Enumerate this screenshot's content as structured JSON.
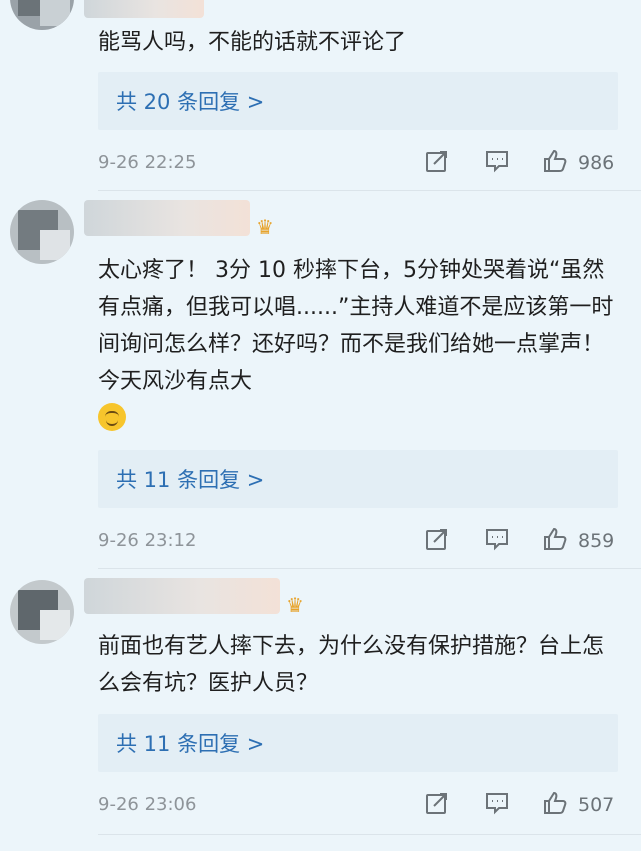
{
  "comments": [
    {
      "text": "能骂人吗，不能的话就不评论了",
      "replies": "共 20 条回复 >",
      "time": "9-26 22:25",
      "likes": "986"
    },
    {
      "text": "太心疼了！ 3分 10 秒摔下台，5分钟处哭着说“虽然有点痛，但我可以唱......”主持人难道不是应该第一时间询问怎么样？还好吗？而不是我们给她一点掌声！今天风沙有点大",
      "replies": "共 11 条回复 >",
      "time": "9-26 23:12",
      "likes": "859"
    },
    {
      "text": "前面也有艺人摔下去，为什么没有保护措施？台上怎么会有坑？医护人员？",
      "replies": "共 11 条回复 >",
      "time": "9-26 23:06",
      "likes": "507"
    }
  ],
  "icons": {
    "share": "share-icon",
    "comment": "comment-icon",
    "like": "thumbs-up-icon",
    "crown": "crown-icon",
    "emoji": "upside-down-face-emoji"
  },
  "colors": {
    "link": "#2d6fb3",
    "reply_bg": "#e3eef5",
    "page_bg": "#ecf5fa"
  }
}
